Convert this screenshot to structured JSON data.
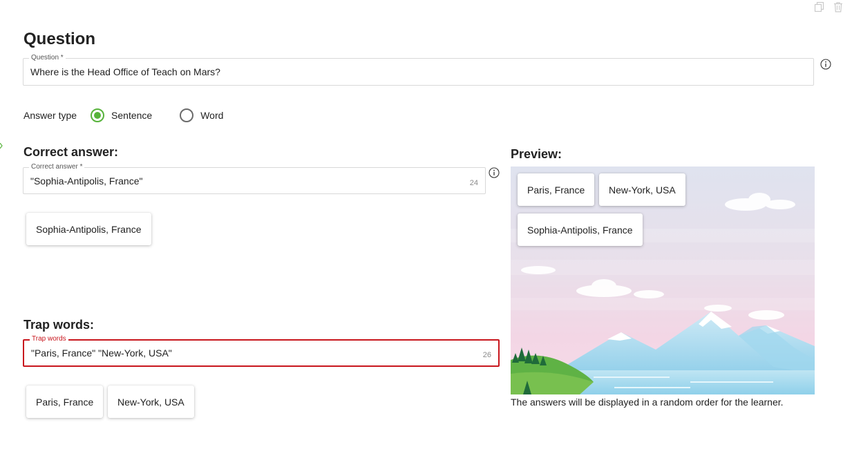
{
  "header": {
    "title": "Question",
    "copy_icon": "copy-icon",
    "delete_icon": "trash-icon"
  },
  "question": {
    "label": "Question *",
    "value": "Where is the Head Office of Teach on Mars?",
    "info_icon": "info-icon"
  },
  "answer_type": {
    "label": "Answer type",
    "options": [
      {
        "label": "Sentence",
        "selected": true
      },
      {
        "label": "Word",
        "selected": false
      }
    ],
    "accent_color": "#57b33b"
  },
  "correct_answer": {
    "heading": "Correct answer:",
    "label": "Correct answer *",
    "value": "\"Sophia-Antipolis, France\"",
    "count": "24",
    "chips": [
      "Sophia-Antipolis, France"
    ]
  },
  "trap_words": {
    "heading": "Trap words:",
    "label": "Trap words",
    "value": "\"Paris, France\" \"New-York, USA\"",
    "count": "26",
    "error_color": "#c8161d",
    "chips": [
      "Paris, France",
      "New-York, USA"
    ]
  },
  "preview": {
    "heading": "Preview:",
    "chips": [
      "Paris, France",
      "New-York, USA",
      "Sophia-Antipolis, France"
    ],
    "note": "The answers will be displayed in a random order for the learner."
  }
}
